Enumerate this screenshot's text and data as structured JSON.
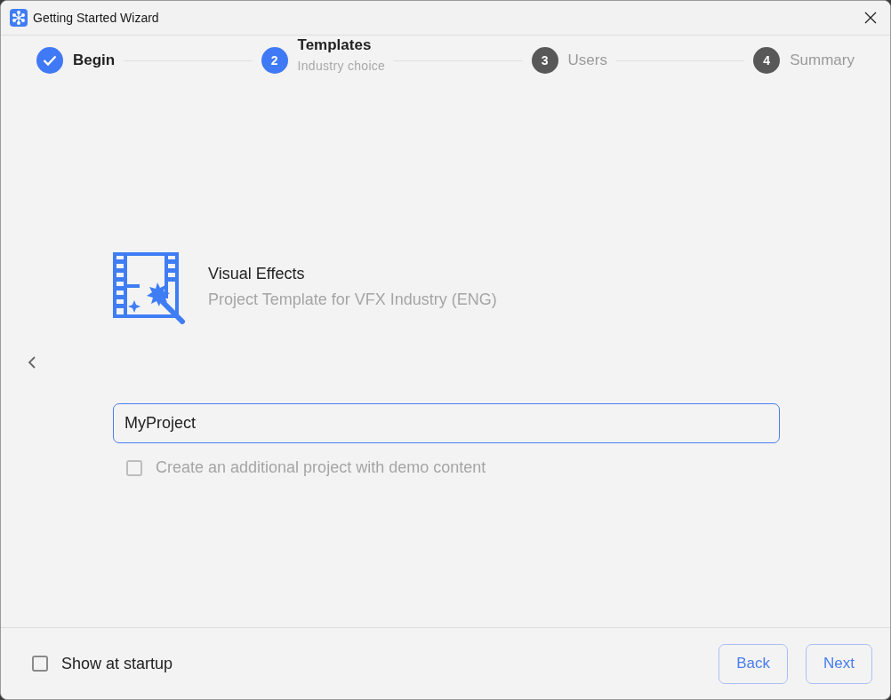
{
  "window": {
    "title": "Getting Started Wizard"
  },
  "steps": [
    {
      "kind": "done",
      "label": "Begin"
    },
    {
      "kind": "current",
      "number": "2",
      "label": "Templates",
      "sublabel": "Industry choice"
    },
    {
      "kind": "pending",
      "number": "3",
      "label": "Users"
    },
    {
      "kind": "pending",
      "number": "4",
      "label": "Summary"
    }
  ],
  "template": {
    "title": "Visual Effects",
    "description": "Project Template for VFX Industry (ENG)"
  },
  "project_name": {
    "value": "MyProject"
  },
  "demo_option": {
    "label": "Create an additional project with demo content",
    "checked": false,
    "disabled": true
  },
  "footer": {
    "show_at_startup": {
      "label": "Show at startup",
      "checked": false
    },
    "buttons": [
      "Back",
      "Next"
    ]
  }
}
